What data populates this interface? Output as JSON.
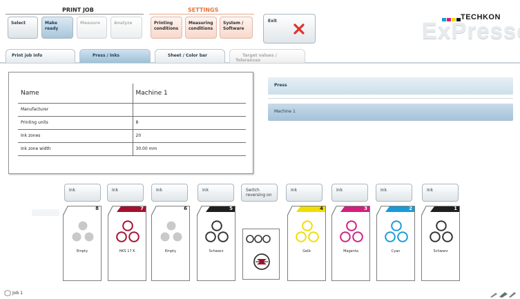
{
  "header": {
    "print_job_title": "PRINT JOB",
    "settings_title": "SETTINGS",
    "print_job_buttons": [
      {
        "label": "Select",
        "state": "normal"
      },
      {
        "label": "Make ready",
        "state": "active"
      },
      {
        "label": "Measure",
        "state": "disabled"
      },
      {
        "label": "Analyze",
        "state": "disabled"
      }
    ],
    "settings_buttons": [
      {
        "label1": "Printing",
        "label2": "conditions"
      },
      {
        "label1": "Measuring",
        "label2": "conditions"
      },
      {
        "label1": "System /",
        "label2": "Software"
      }
    ],
    "exit_label": "Exit",
    "logo_brand": "TECHKON",
    "logo_product": "ExPresso",
    "colors": {
      "print_job_accent": "#7d7d7d",
      "settings_accent": "#e8743c",
      "exit_x": "#e0312b",
      "active_blue": "#a8c6da"
    }
  },
  "tabs": [
    {
      "label": "Print job info",
      "state": "normal"
    },
    {
      "label": "Press / Inks",
      "state": "active"
    },
    {
      "label": "Sheet / Color bar",
      "state": "normal"
    },
    {
      "label": "Target values / Tolerances",
      "state": "disabled"
    }
  ],
  "machine_table": {
    "header_name": "Name",
    "header_value": "Machine 1",
    "rows": [
      {
        "label": "Manufacturer",
        "value": ""
      },
      {
        "label": "Printing units",
        "value": "8"
      },
      {
        "label": "Ink zones",
        "value": "20"
      },
      {
        "label": "Ink zone width",
        "value": "30.00 mm"
      }
    ]
  },
  "press_panel": {
    "title": "Press",
    "selected": "Machine 1"
  },
  "ink_buttons": [
    {
      "line1": "Ink",
      "line2": ""
    },
    {
      "line1": "Ink",
      "line2": ""
    },
    {
      "line1": "Ink",
      "line2": ""
    },
    {
      "line1": "Ink",
      "line2": ""
    },
    {
      "line1": "Switch",
      "line2": "reversing on"
    },
    {
      "line1": "Ink",
      "line2": ""
    },
    {
      "line1": "Ink",
      "line2": ""
    },
    {
      "line1": "Ink",
      "line2": ""
    },
    {
      "line1": "Ink",
      "line2": ""
    }
  ],
  "printing_units": [
    {
      "number": "8",
      "label": "Empty",
      "color": "#c9c9c9",
      "band": ""
    },
    {
      "number": "7",
      "label": "HKS 17 K",
      "color": "#a5102f",
      "band": "#a5102f"
    },
    {
      "number": "6",
      "label": "Empty",
      "color": "#c9c9c9",
      "band": ""
    },
    {
      "number": "5",
      "label": "Schwarz",
      "color": "#333333",
      "band": "#1f1f1f"
    },
    {
      "number": "4",
      "label": "Gelb",
      "color": "#f0de00",
      "band": "#f0de00"
    },
    {
      "number": "3",
      "label": "Magenta",
      "color": "#d21f7c",
      "band": "#d21f7c"
    },
    {
      "number": "2",
      "label": "Cyan",
      "color": "#1a9ad6",
      "band": "#1a9ad6"
    },
    {
      "number": "1",
      "label": "Schwarz",
      "color": "#333333",
      "band": "#1f1f1f"
    }
  ],
  "footer": {
    "job_label": "Job 1"
  }
}
